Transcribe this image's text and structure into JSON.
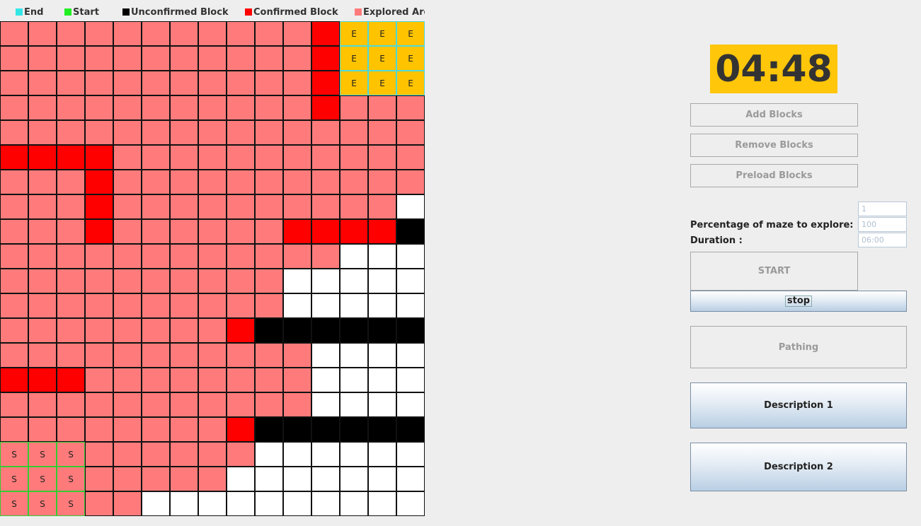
{
  "legend": [
    {
      "label": "End",
      "color": "#33e6e6",
      "icon": "cyan-square-icon"
    },
    {
      "label": "Start",
      "color": "#22ee22",
      "icon": "green-square-icon"
    },
    {
      "label": "Unconfirmed Block",
      "color": "#000000",
      "icon": "black-square-icon"
    },
    {
      "label": "Confirmed Block",
      "color": "#ff0000",
      "icon": "red-square-icon"
    },
    {
      "label": "Explored Are",
      "color": "#ff7b7b",
      "icon": "pink-square-icon"
    }
  ],
  "grid": {
    "rows": [
      "EEEEEEEEEEECXXX",
      "EEEEEEEEEEECXXX",
      "EEEEEEEEEEECXXX",
      "EEEEEEEEEEECEEE",
      "EEEEEEEEEEEEEEE",
      "CCCCEEEEEEEEEEE",
      "EEECEEEEEEEEEEE",
      "EEECEEEEEEEEEEW",
      "EEECEEEEEECCCCB",
      "EEEEEEEEEEEEWWW",
      "EEEEEEEEEEWWWWW",
      "EEEEEEEEEEWWWWW",
      "EEEEEEEECBBBBBB",
      "EEEEEEEEEEEWWWW",
      "CCCEEEEEEEEWWWW",
      "EEEEEEEEEEEWWWW",
      "EEEEEEEECBBBBBB",
      "SSSEEEEEEWWWWWW",
      "SSSEEEEEWWWWWWW",
      "SSSEEWWWWWWWWWW"
    ],
    "end_mark": "E",
    "start_mark": "S"
  },
  "timer": "04:48",
  "buttons": {
    "add_blocks": "Add Blocks",
    "remove_blocks": "Remove Blocks",
    "preload_blocks": "Preload Blocks",
    "start": "START",
    "stop": "stop",
    "pathing": "Pathing",
    "description1": "Description 1",
    "description2": "Description 2"
  },
  "fields": {
    "top_value": "1",
    "percentage_label": "Percentage of maze to explore:",
    "percentage_value": "100",
    "duration_label": "Duration :",
    "duration_value": "06:00"
  }
}
